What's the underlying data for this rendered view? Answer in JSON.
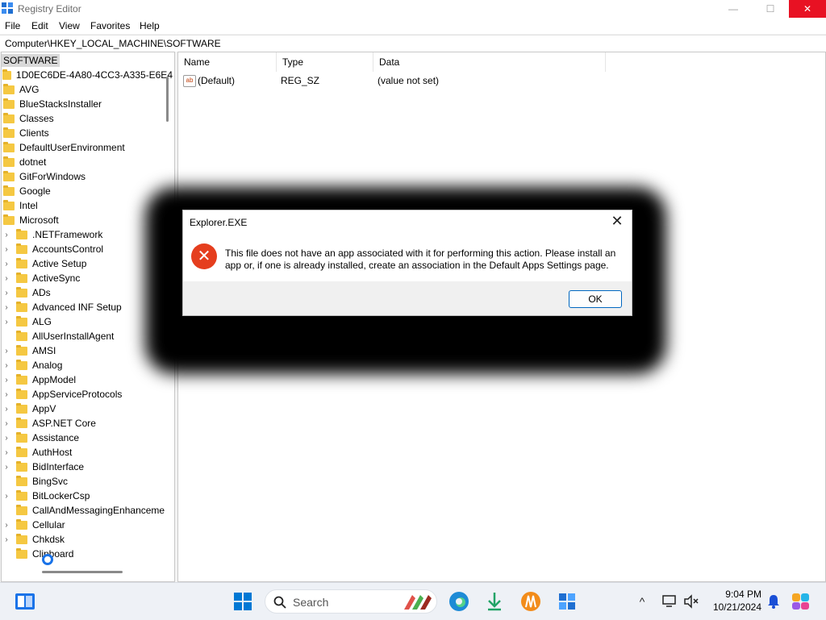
{
  "window": {
    "title": "Registry Editor",
    "minimize": "—",
    "maximize": "☐",
    "close": "✕"
  },
  "menu": [
    "File",
    "Edit",
    "View",
    "Favorites",
    "Help"
  ],
  "address": "Computer\\HKEY_LOCAL_MACHINE\\SOFTWARE",
  "tree": {
    "root": "SOFTWARE",
    "items": [
      {
        "label": "1D0EC6DE-4A80-4CC3-A335-E6E4",
        "chev": false
      },
      {
        "label": "AVG",
        "chev": false
      },
      {
        "label": "BlueStacksInstaller",
        "chev": false
      },
      {
        "label": "Classes",
        "chev": false
      },
      {
        "label": "Clients",
        "chev": false
      },
      {
        "label": "DefaultUserEnvironment",
        "chev": false
      },
      {
        "label": "dotnet",
        "chev": false
      },
      {
        "label": "GitForWindows",
        "chev": false
      },
      {
        "label": "Google",
        "chev": false
      },
      {
        "label": "Intel",
        "chev": false
      },
      {
        "label": "Microsoft",
        "chev": false
      },
      {
        "label": ".NETFramework",
        "chev": true
      },
      {
        "label": "AccountsControl",
        "chev": true
      },
      {
        "label": "Active Setup",
        "chev": true
      },
      {
        "label": "ActiveSync",
        "chev": true
      },
      {
        "label": "ADs",
        "chev": true
      },
      {
        "label": "Advanced INF Setup",
        "chev": true
      },
      {
        "label": "ALG",
        "chev": true
      },
      {
        "label": "AllUserInstallAgent",
        "chev": false
      },
      {
        "label": "AMSI",
        "chev": true
      },
      {
        "label": "Analog",
        "chev": true
      },
      {
        "label": "AppModel",
        "chev": true
      },
      {
        "label": "AppServiceProtocols",
        "chev": true
      },
      {
        "label": "AppV",
        "chev": true
      },
      {
        "label": "ASP.NET Core",
        "chev": true
      },
      {
        "label": "Assistance",
        "chev": true
      },
      {
        "label": "AuthHost",
        "chev": true
      },
      {
        "label": "BidInterface",
        "chev": true
      },
      {
        "label": "BingSvc",
        "chev": false
      },
      {
        "label": "BitLockerCsp",
        "chev": true
      },
      {
        "label": "CallAndMessagingEnhanceme",
        "chev": false
      },
      {
        "label": "Cellular",
        "chev": true
      },
      {
        "label": "Chkdsk",
        "chev": true
      },
      {
        "label": "Clipboard",
        "chev": false
      }
    ]
  },
  "list": {
    "columns": [
      "Name",
      "Type",
      "Data"
    ],
    "rows": [
      {
        "name": "(Default)",
        "type": "REG_SZ",
        "data": "(value not set)"
      }
    ]
  },
  "dialog": {
    "title": "Explorer.EXE",
    "close": "✕",
    "icon": "✕",
    "message": "This file does not have an app associated with it for performing this action. Please install an app or, if one is already installed, create an association in the Default Apps Settings page.",
    "ok": "OK"
  },
  "taskbar": {
    "search_placeholder": "Search",
    "time": "9:04 PM",
    "date": "10/21/2024",
    "chevron": "^"
  }
}
